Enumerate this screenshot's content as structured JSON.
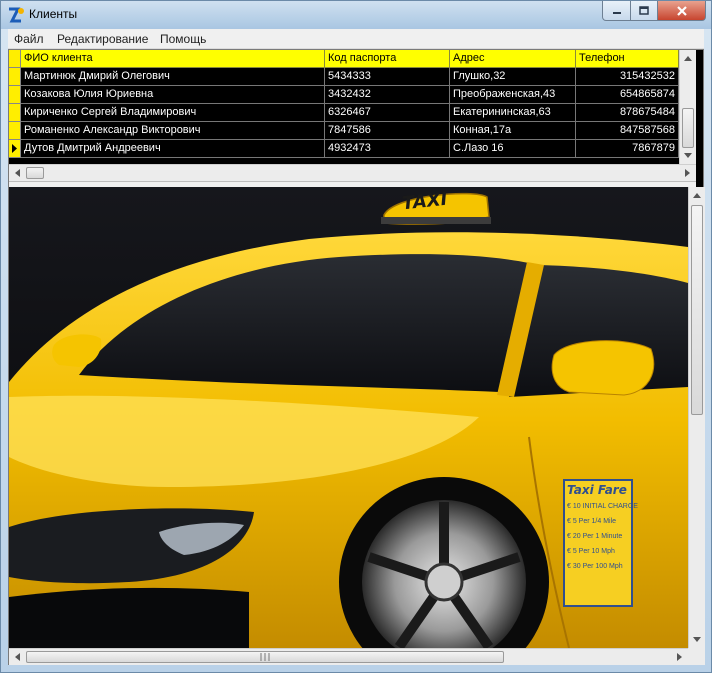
{
  "window": {
    "title": "Клиенты"
  },
  "menu": [
    "Файл",
    "Редактирование",
    "Помощь"
  ],
  "grid": {
    "columns": [
      "ФИО клиента",
      "Код паспорта",
      "Адрес",
      "Телефон"
    ],
    "rows": [
      {
        "name": "Мартинюк Дмирий Олегович",
        "passport": "5434333",
        "address": "Глушко,32",
        "phone": "315432532"
      },
      {
        "name": "Козакова Юлия Юриевна",
        "passport": "3432432",
        "address": "Преображенская,43",
        "phone": "654865874"
      },
      {
        "name": "Кириченко Сергей Владимирович",
        "passport": "6326467",
        "address": "Екатерининская,63",
        "phone": "878675484"
      },
      {
        "name": "Романенко Александр Викторович",
        "passport": "7847586",
        "address": "Конная,17а",
        "phone": "847587568"
      },
      {
        "name": "Дутов Дмитрий Андреевич",
        "passport": "4932473",
        "address": "С.Лазо 16",
        "phone": "7867879"
      }
    ],
    "current_row": 4
  },
  "image": {
    "taxi_sign": "TAXI",
    "fare_panel": {
      "title": "Taxi Fare",
      "lines": [
        "€ 10  INITIAL CHARGE",
        "€ 5  Per 1/4 Mile",
        "€ 20  Per 1 Minute",
        "€ 5  Per 10 Mph",
        "€ 30  Per 100 Mph"
      ]
    }
  },
  "colors": {
    "header_bg": "#ffff00",
    "grid_bg": "#000000",
    "car_yellow": "#f2c100"
  }
}
